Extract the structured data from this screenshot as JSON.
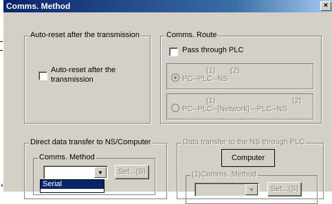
{
  "dialog": {
    "title": "Comms. Method",
    "close_label": "×"
  },
  "auto_reset_group": {
    "title": "Auto-reset after the transmission",
    "checkbox_label_1": "Auto-reset after the",
    "checkbox_label_2": "transmission",
    "checked": false
  },
  "comms_route": {
    "title": "Comms. Route",
    "pass_through_label": "Pass through PLC",
    "opt1_nums_a": "(1)",
    "opt1_nums_b": "(2)",
    "opt1_path": "PC--PLC--NS",
    "opt2_nums_a": "(1)",
    "opt2_nums_b": "(2)",
    "opt2_path": "PC--PLC--[Network]---PLC--NS"
  },
  "direct_transfer": {
    "title": "Direct data transfer to NS/Computer",
    "subgroup_title": "Comms. Method",
    "combo_value": "",
    "set_label": "Set...(S)"
  },
  "through_plc": {
    "title": "Data transfer to the NS through PLC",
    "computer_label": "Computer",
    "subgroup_title": "(1)Comms. Method",
    "set_label": "Set...(S)"
  },
  "dropdown": {
    "items": [
      "Serial"
    ]
  }
}
